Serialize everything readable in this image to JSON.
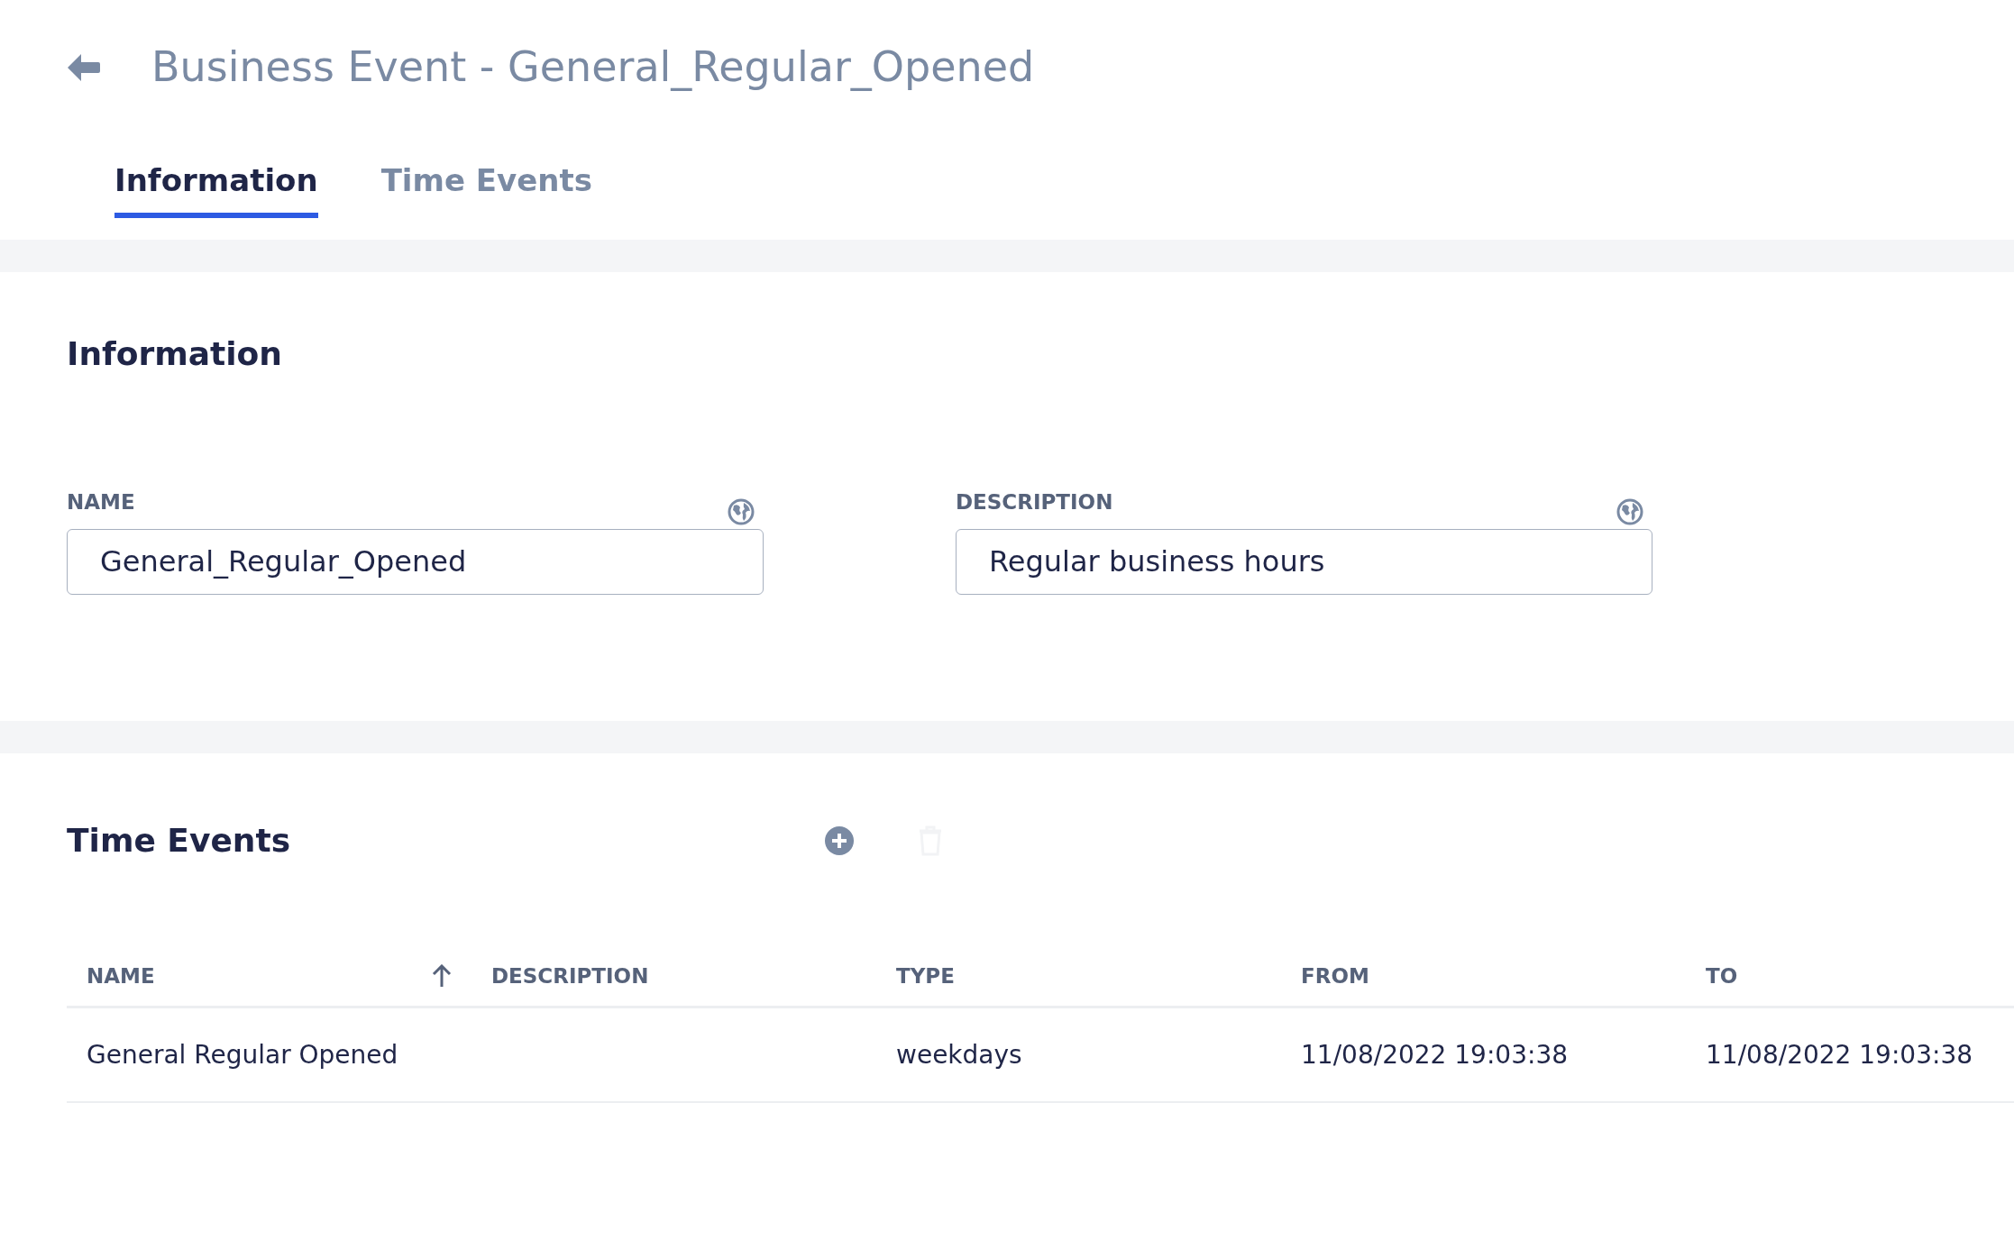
{
  "header": {
    "title": "Business Event - General_Regular_Opened"
  },
  "tabs": [
    {
      "label": "Information",
      "selected": true
    },
    {
      "label": "Time Events",
      "selected": false
    }
  ],
  "information": {
    "heading": "Information",
    "fields": [
      {
        "label": "NAME",
        "value": "General_Regular_Opened"
      },
      {
        "label": "DESCRIPTION",
        "value": "Regular business hours"
      }
    ]
  },
  "time_events": {
    "heading": "Time Events",
    "actions": [
      {
        "kind": "add",
        "disabled": false
      },
      {
        "kind": "delete",
        "disabled": true
      }
    ],
    "table": {
      "columns": [
        {
          "label": "NAME",
          "sorted": true
        },
        {
          "label": "DESCRIPTION",
          "sorted": false
        },
        {
          "label": "TYPE",
          "sorted": false
        },
        {
          "label": "FROM",
          "sorted": false
        },
        {
          "label": "TO",
          "sorted": false
        }
      ],
      "rows": [
        [
          "General Regular Opened",
          "",
          "weekdays",
          "11/08/2022 19:03:38",
          "11/08/2022 19:03:38"
        ]
      ]
    }
  }
}
